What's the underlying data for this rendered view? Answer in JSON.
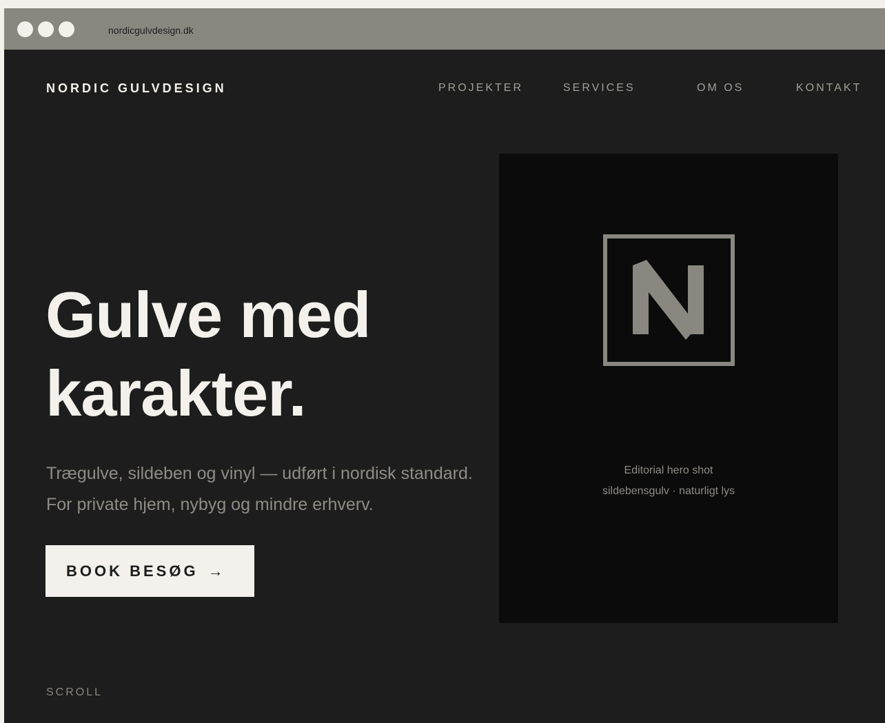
{
  "browser": {
    "url": "nordicgulvdesign.dk"
  },
  "header": {
    "brand": "NORDIC GULVDESIGN",
    "nav": [
      "PROJEKTER",
      "SERVICES",
      "OM OS",
      "KONTAKT"
    ]
  },
  "hero": {
    "headline_line1": "Gulve med",
    "headline_line2": "karakter.",
    "subtitle_line1": "Trægulve, sildeben og vinyl — udført i nordisk standard.",
    "subtitle_line2": "For private hjem, nybyg og mindre erhverv.",
    "cta_label": "BOOK BESØG",
    "cta_arrow": "→"
  },
  "hero_image": {
    "logo_letter": "N",
    "caption_line1": "Editorial hero shot",
    "caption_line2": "sildebensgulv · naturligt lys"
  },
  "footer": {
    "scroll_label": "SCROLL"
  },
  "colors": {
    "background": "#1d1d1d",
    "accent_light": "#f4f1ec",
    "muted": "#8a8780",
    "image_panel": "#0b0b0b"
  },
  "icons": [
    "window-dot",
    "arrow-right-icon",
    "n-logo-icon"
  ]
}
